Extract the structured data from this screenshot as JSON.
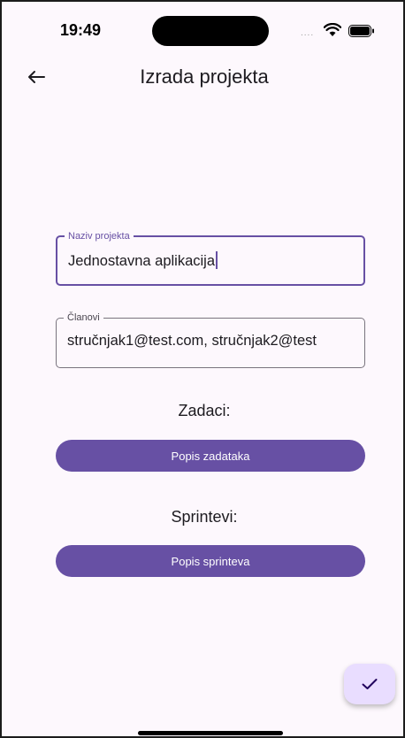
{
  "status_bar": {
    "time": "19:49",
    "cell_signal": "....",
    "icons": [
      "wifi-icon",
      "battery-icon"
    ]
  },
  "app_bar": {
    "title": "Izrada projekta",
    "back_icon": "arrow-left-icon"
  },
  "form": {
    "project_name": {
      "label": "Naziv projekta",
      "value": "Jednostavna aplikacija",
      "focused": true
    },
    "members": {
      "label": "Članovi",
      "value": "stručnjak1@test.com, stručnjak2@test"
    },
    "tasks": {
      "heading": "Zadaci:",
      "button_label": "Popis zadataka"
    },
    "sprints": {
      "heading": "Sprintevi:",
      "button_label": "Popis sprinteva"
    }
  },
  "fab": {
    "icon": "check-icon"
  },
  "colors": {
    "primary": "#6750a4",
    "background": "#fdf8fd",
    "fab_container": "#e9ddff"
  }
}
